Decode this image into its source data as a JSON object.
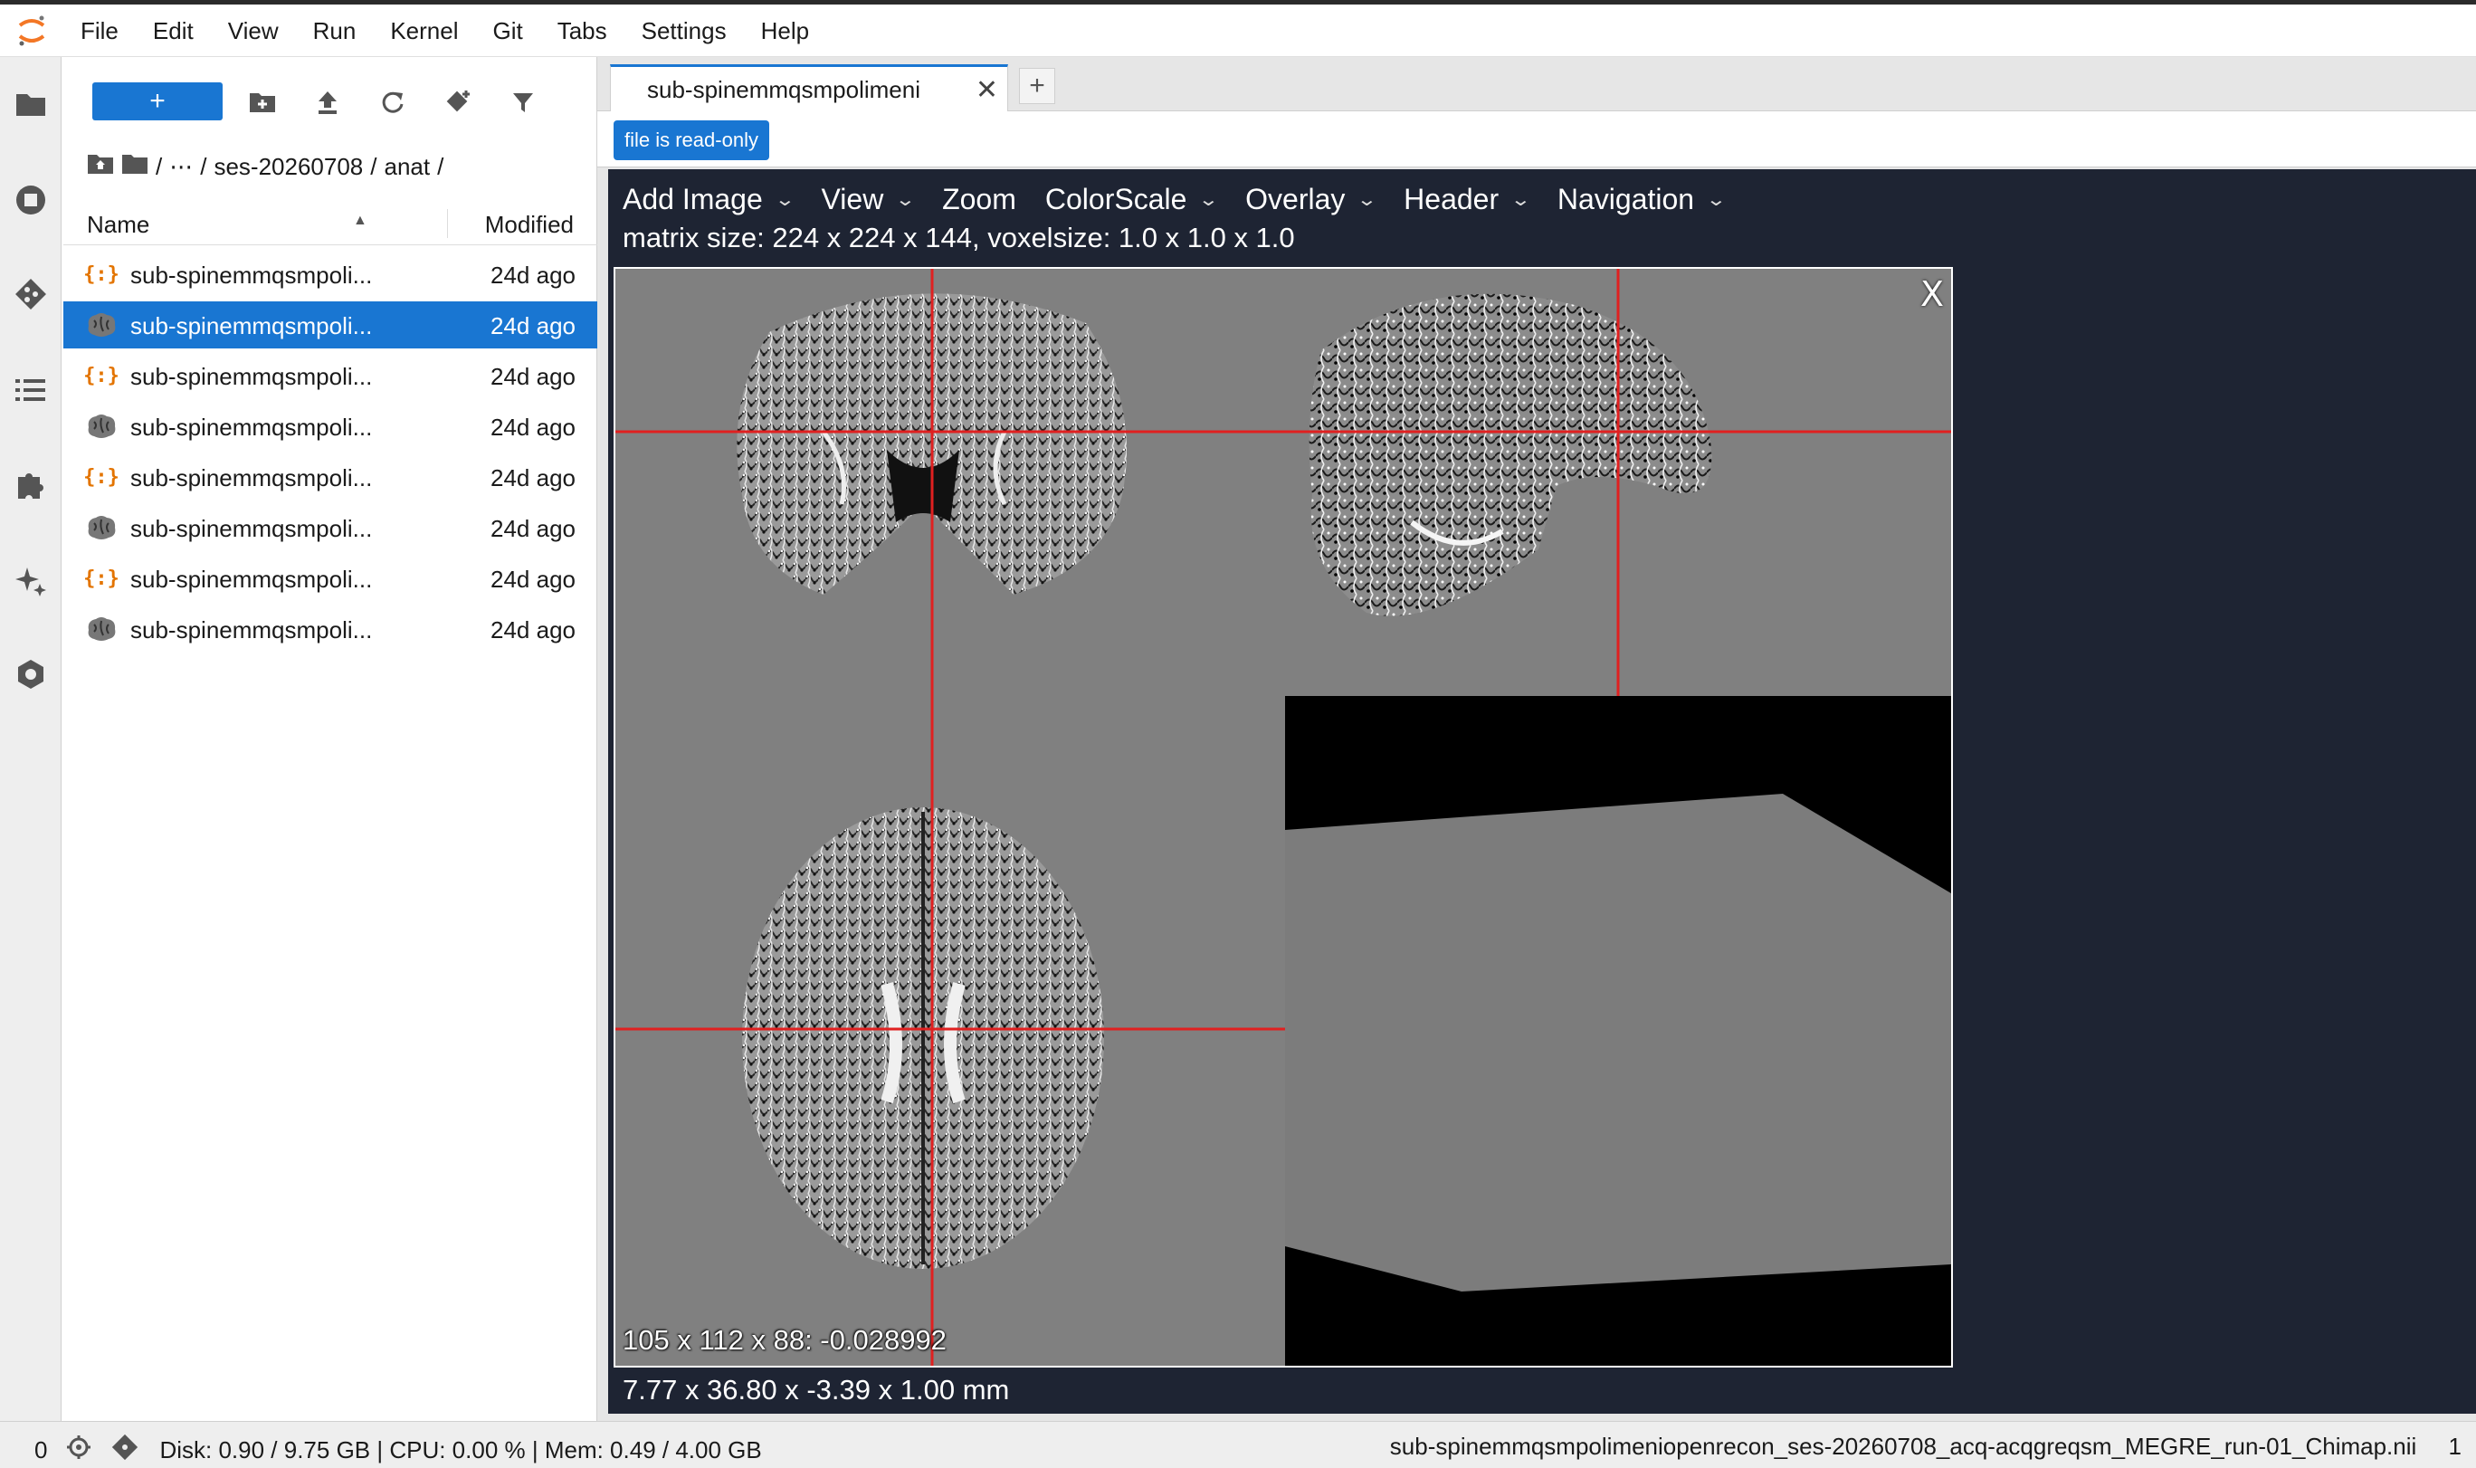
{
  "menubar": {
    "items": [
      "File",
      "Edit",
      "View",
      "Run",
      "Kernel",
      "Git",
      "Tabs",
      "Settings",
      "Help"
    ]
  },
  "sidebar_icons": [
    "folder-icon",
    "running-icon",
    "git-icon",
    "toc-icon",
    "extensions-icon",
    "ai-assistant-icon",
    "property-inspector-icon"
  ],
  "browser": {
    "new_label": "+",
    "breadcrumb": {
      "sep1": "/",
      "ellipsis": "⋯",
      "sep2": "/",
      "folder1": "ses-20260708",
      "sep3": "/",
      "folder2": "anat",
      "sep4": "/"
    },
    "columns": {
      "name": "Name",
      "modified": "Modified"
    },
    "files": [
      {
        "icon": "json-icon",
        "name": "sub-spinemmqsmpoli...",
        "modified": "24d ago",
        "selected": false
      },
      {
        "icon": "brain-icon",
        "name": "sub-spinemmqsmpoli...",
        "modified": "24d ago",
        "selected": true
      },
      {
        "icon": "json-icon",
        "name": "sub-spinemmqsmpoli...",
        "modified": "24d ago",
        "selected": false
      },
      {
        "icon": "brain-icon",
        "name": "sub-spinemmqsmpoli...",
        "modified": "24d ago",
        "selected": false
      },
      {
        "icon": "json-icon",
        "name": "sub-spinemmqsmpoli...",
        "modified": "24d ago",
        "selected": false
      },
      {
        "icon": "brain-icon",
        "name": "sub-spinemmqsmpoli...",
        "modified": "24d ago",
        "selected": false
      },
      {
        "icon": "json-icon",
        "name": "sub-spinemmqsmpoli...",
        "modified": "24d ago",
        "selected": false
      },
      {
        "icon": "brain-icon",
        "name": "sub-spinemmqsmpoli...",
        "modified": "24d ago",
        "selected": false
      }
    ]
  },
  "tabs": {
    "active_label": "sub-spinemmqsmpolimeni",
    "close": "✕",
    "add": "+"
  },
  "doc": {
    "readonly_badge": "file is read-only"
  },
  "viewer": {
    "menu": [
      {
        "label": "Add Image",
        "chevron": "⌄"
      },
      {
        "label": "View",
        "chevron": "⌄"
      },
      {
        "label": "Zoom",
        "chevron": ""
      },
      {
        "label": "ColorScale",
        "chevron": "⌄"
      },
      {
        "label": "Overlay",
        "chevron": "⌄"
      },
      {
        "label": "Header",
        "chevron": "⌄"
      },
      {
        "label": "Navigation",
        "chevron": "⌄"
      }
    ],
    "matrix_info": "matrix size: 224 x 224 x 144, voxelsize: 1.0 x 1.0 x 1.0",
    "close_label": "X",
    "voxel_readout": "105 x 112 x 88: -0.028992",
    "coords_readout": "7.77 x 36.80 x -3.39 x 1.00 mm",
    "crosshair_color": "#e02020"
  },
  "status": {
    "kernels": "0",
    "resources": "Disk: 0.90 / 9.75 GB | CPU: 0.00 % | Mem: 0.49 / 4.00 GB",
    "filename": "sub-spinemmqsmpolimeniopenrecon_ses-20260708_acq-acqgreqsm_MEGRE_run-01_Chimap.nii",
    "line": "1"
  },
  "colors": {
    "accent": "#1976d2",
    "viewer_bg": "#1e2433",
    "json_icon": "#e37400"
  }
}
